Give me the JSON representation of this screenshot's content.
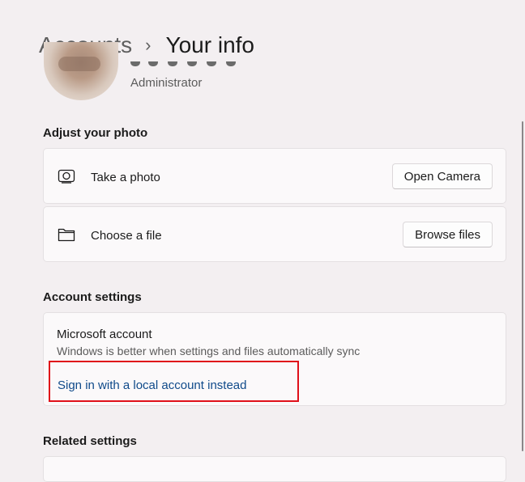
{
  "breadcrumb": {
    "parent": "Accounts",
    "separator": "›",
    "current": "Your info"
  },
  "user": {
    "role": "Administrator"
  },
  "adjust_photo": {
    "title": "Adjust your photo",
    "rows": [
      {
        "icon": "camera-icon",
        "label": "Take a photo",
        "button": "Open Camera"
      },
      {
        "icon": "folder-icon",
        "label": "Choose a file",
        "button": "Browse files"
      }
    ]
  },
  "account_settings": {
    "title": "Account settings",
    "microsoft_account": {
      "title": "Microsoft account",
      "description": "Windows is better when settings and files automatically sync",
      "link": "Sign in with a local account instead"
    }
  },
  "related_settings": {
    "title": "Related settings"
  },
  "colors": {
    "background": "#f3eff1",
    "card": "#fbf9fa",
    "link": "#0f4a8a",
    "highlight": "#e0101a"
  }
}
